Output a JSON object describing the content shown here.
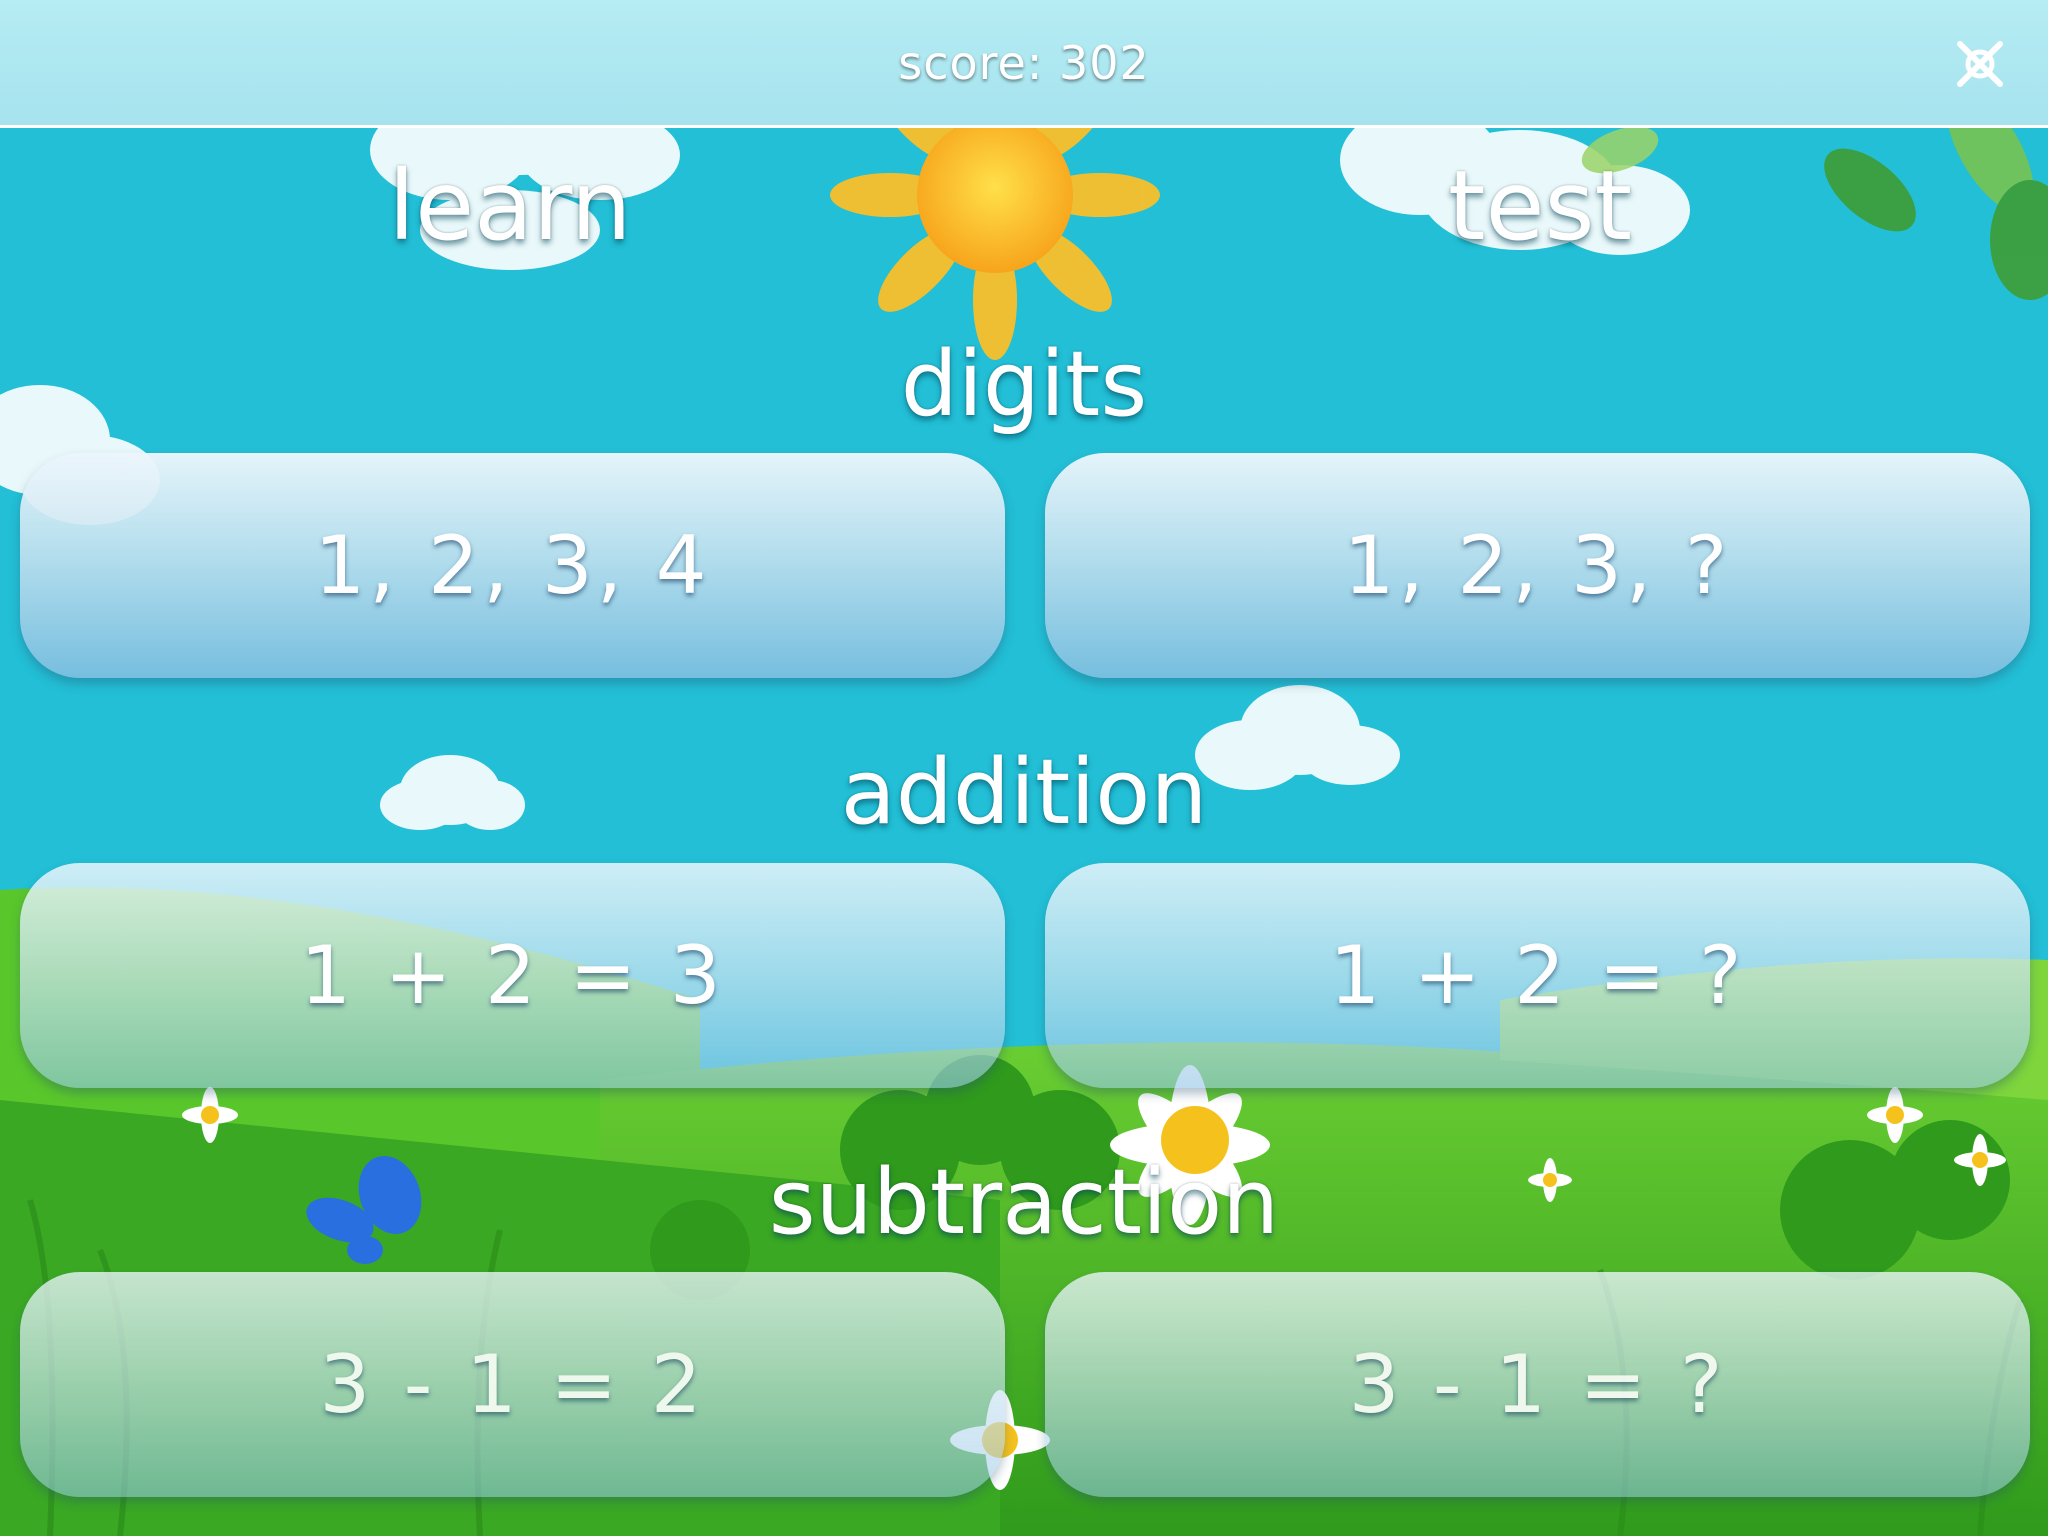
{
  "header": {
    "score_text": "score: 302",
    "close_icon": "close-x-icon"
  },
  "columns": {
    "learn_label": "learn",
    "test_label": "test"
  },
  "sections": [
    {
      "title": "digits",
      "learn": "1, 2, 3, 4",
      "test": "1, 2, 3, ?"
    },
    {
      "title": "addition",
      "learn": "1 + 2 = 3",
      "test": "1 + 2 = ?"
    },
    {
      "title": "subtraction",
      "learn": "3 - 1 = 2",
      "test": "3 - 1 = ?"
    }
  ],
  "colors": {
    "sky": "#22bfd6",
    "topbar": "#aee8f1",
    "grass": "#4cc22c",
    "text": "#ffffff"
  }
}
